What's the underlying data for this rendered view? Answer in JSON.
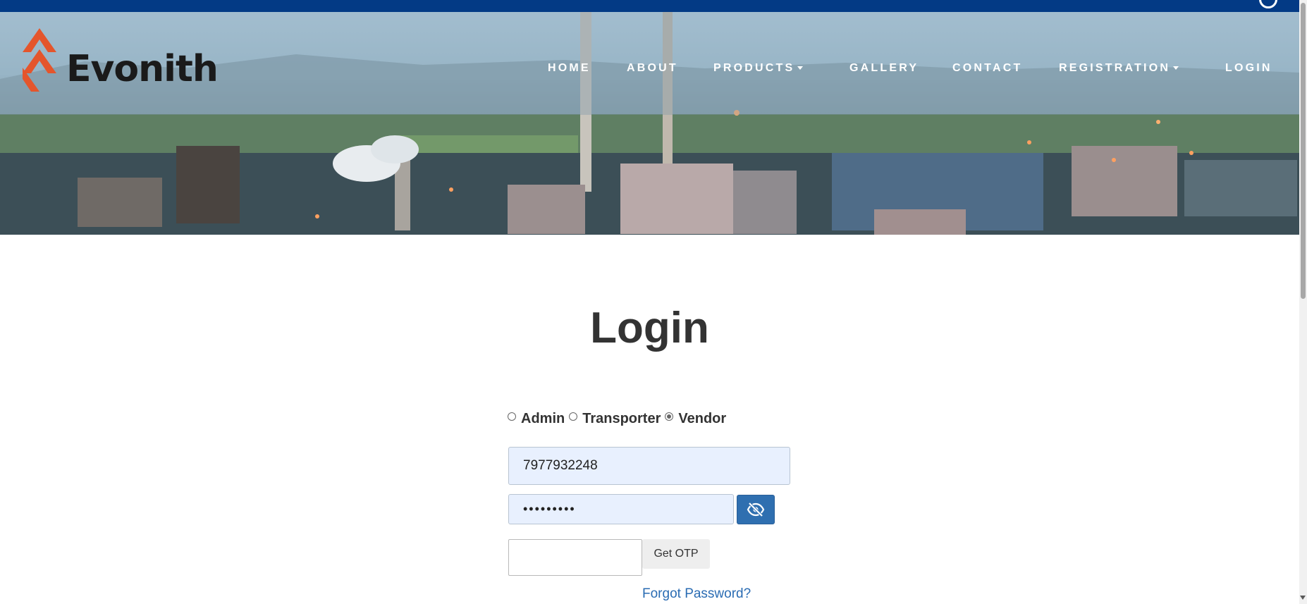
{
  "brand": {
    "logo_text": "Evonith"
  },
  "nav": {
    "items": [
      {
        "label": "HOME",
        "has_dropdown": false
      },
      {
        "label": "ABOUT",
        "has_dropdown": false
      },
      {
        "label": "PRODUCTS",
        "has_dropdown": true
      },
      {
        "label": "GALLERY",
        "has_dropdown": false
      },
      {
        "label": "CONTACT",
        "has_dropdown": false
      },
      {
        "label": "REGISTRATION",
        "has_dropdown": true
      },
      {
        "label": "LOGIN",
        "has_dropdown": false
      }
    ]
  },
  "login": {
    "title": "Login",
    "roles": [
      {
        "label": "Admin",
        "selected": false
      },
      {
        "label": "Transporter",
        "selected": false
      },
      {
        "label": "Vendor",
        "selected": true
      }
    ],
    "phone_value": "7977932248",
    "password_masked": "•••••••••",
    "otp_value": "",
    "get_otp_label": "Get OTP",
    "forgot_label": "Forgot Password?"
  },
  "colors": {
    "top_bar": "#033a85",
    "eye_button": "#2f6fb0",
    "link": "#2a6cb3",
    "logo_accent": "#e4552c"
  },
  "icons": {
    "password_toggle": "eye-slash-icon",
    "logo_mark": "chevron-arrows-icon"
  }
}
